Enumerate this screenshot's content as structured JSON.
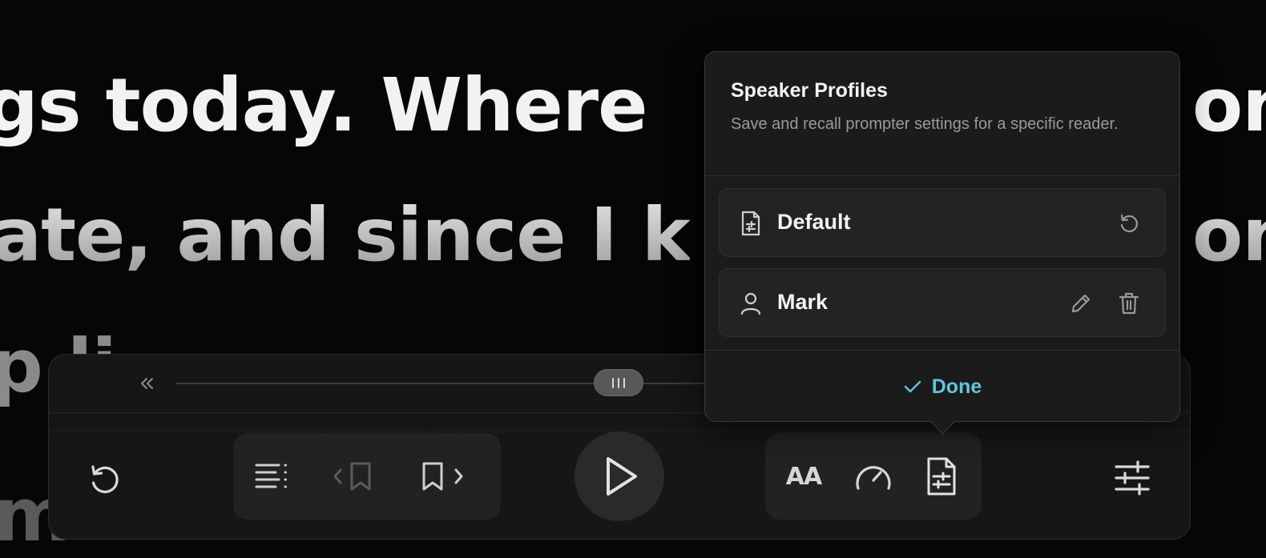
{
  "prompter": {
    "line1": "gs today. Where",
    "line1_right": "on",
    "line2": "ate, and since I k",
    "line2_right": "on",
    "line3": "p li",
    "line4": "m"
  },
  "popover": {
    "title": "Speaker Profiles",
    "description": "Save and recall prompter settings for a specific reader.",
    "profiles": [
      {
        "name": "Default",
        "icon": "document-icon",
        "action": "reset-icon"
      },
      {
        "name": "Mark",
        "icon": "user-icon",
        "actions": [
          "pencil-icon",
          "trash-icon"
        ]
      }
    ],
    "done_label": "Done"
  },
  "controls": {
    "font_label": "AA",
    "accent_color": "#5fc7dc"
  }
}
